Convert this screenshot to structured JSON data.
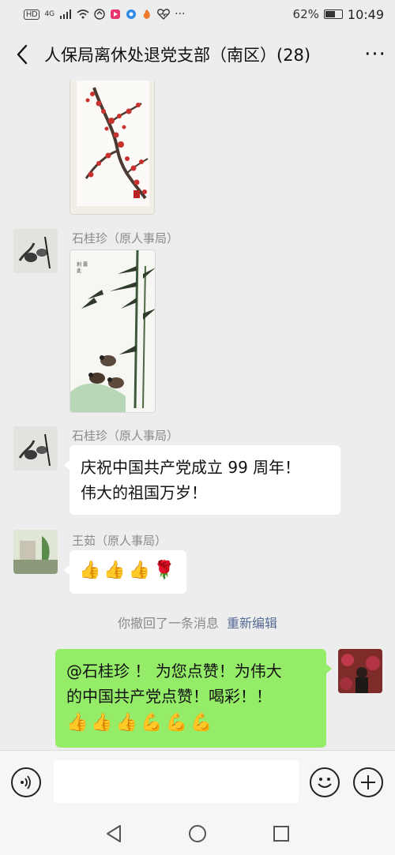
{
  "status_bar": {
    "left_icons": [
      "hd-icon",
      "signal-icon",
      "wifi-icon",
      "app-icon",
      "app-icon",
      "app-icon",
      "app-icon",
      "heart-icon",
      "more-dots-icon"
    ],
    "network_label": "4G",
    "battery_percent": "62%",
    "battery_level": 0.62,
    "time": "10:49"
  },
  "header": {
    "title": "人保局离休处退党支部（南区）(28)",
    "more_label": "···"
  },
  "messages": [
    {
      "type": "image",
      "content": "plum-blossom-painting"
    },
    {
      "type": "image",
      "sender": "石桂珍（原人事局）",
      "content": "bamboo-birds-painting"
    },
    {
      "type": "text",
      "sender": "石桂珍（原人事局）",
      "lines": [
        "庆祝中国共产党成立 99 周年！",
        "伟大的祖国万岁！"
      ]
    },
    {
      "type": "emoji",
      "sender": "王茹（原人事局）",
      "emojis": [
        "👍",
        "👍",
        "👍",
        "🌹"
      ]
    },
    {
      "type": "system",
      "text": "你撤回了一条消息",
      "link": "重新编辑"
    },
    {
      "type": "self-text",
      "lines": [
        "@石桂珍 ！ 为您点赞！为伟大",
        "的中国共产党点赞！喝彩！！"
      ],
      "emojis": [
        "👍",
        "👍",
        "👍",
        "💪",
        "💪",
        "💪"
      ]
    }
  ],
  "input_bar": {
    "placeholder": ""
  },
  "nav_bar": {
    "buttons": [
      "back-triangle",
      "home-circle",
      "recents-square"
    ]
  }
}
